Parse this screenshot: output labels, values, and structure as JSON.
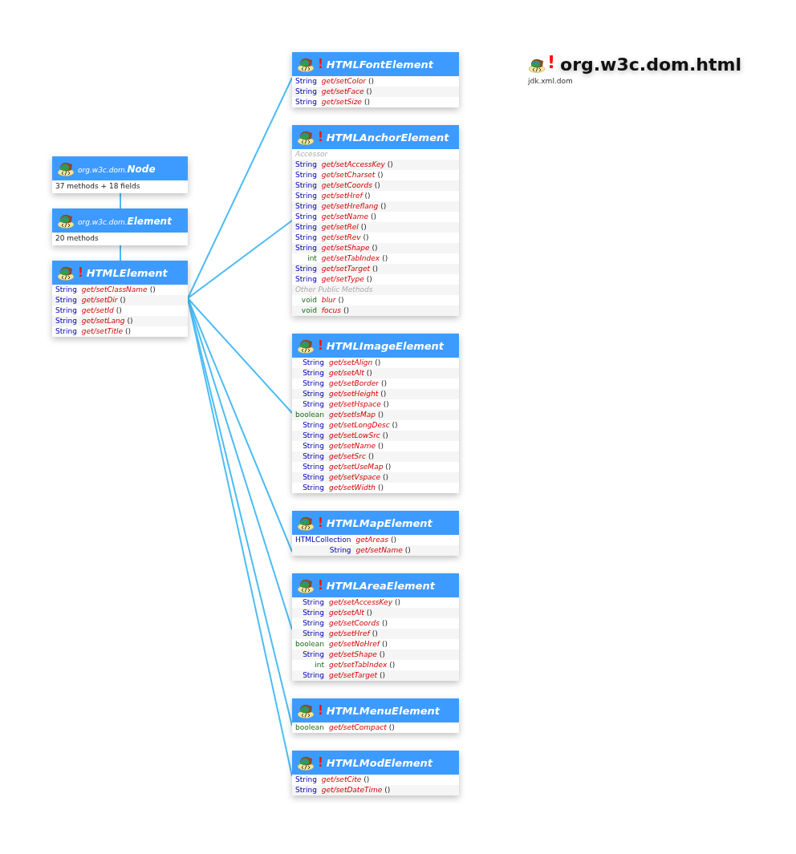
{
  "title": {
    "mark": "!",
    "package": "org.w3c.dom.html",
    "module": "jdk.xml.dom"
  },
  "classes": [
    {
      "kind": "external",
      "prefix": "org.w3c.dom.",
      "name": "Node",
      "summary": "37 methods + 18 fields"
    },
    {
      "kind": "external",
      "prefix": "org.w3c.dom.",
      "name": "Element",
      "summary": "20 methods"
    },
    {
      "kind": "interface",
      "mark": "!",
      "name": "HTMLElement",
      "rows": [
        {
          "kind": "object",
          "type": "String",
          "name": "get/setClassName",
          "params": "()"
        },
        {
          "kind": "object",
          "type": "String",
          "name": "get/setDir",
          "params": "()"
        },
        {
          "kind": "object",
          "type": "String",
          "name": "get/setId",
          "params": "()"
        },
        {
          "kind": "object",
          "type": "String",
          "name": "get/setLang",
          "params": "()"
        },
        {
          "kind": "object",
          "type": "String",
          "name": "get/setTitle",
          "params": "()"
        }
      ]
    },
    {
      "kind": "interface",
      "mark": "!",
      "name": "HTMLFontElement",
      "rows": [
        {
          "kind": "object",
          "type": "String",
          "name": "get/setColor",
          "params": "()"
        },
        {
          "kind": "object",
          "type": "String",
          "name": "get/setFace",
          "params": "()"
        },
        {
          "kind": "object",
          "type": "String",
          "name": "get/setSize",
          "params": "()"
        }
      ]
    },
    {
      "kind": "interface",
      "mark": "!",
      "name": "HTMLAnchorElement",
      "rows": [
        {
          "kind": "section",
          "label": "Accessor"
        },
        {
          "kind": "object",
          "type": "String",
          "name": "get/setAccessKey",
          "params": "()"
        },
        {
          "kind": "object",
          "type": "String",
          "name": "get/setCharset",
          "params": "()"
        },
        {
          "kind": "object",
          "type": "String",
          "name": "get/setCoords",
          "params": "()"
        },
        {
          "kind": "object",
          "type": "String",
          "name": "get/setHref",
          "params": "()"
        },
        {
          "kind": "object",
          "type": "String",
          "name": "get/setHreflang",
          "params": "()"
        },
        {
          "kind": "object",
          "type": "String",
          "name": "get/setName",
          "params": "()"
        },
        {
          "kind": "object",
          "type": "String",
          "name": "get/setRel",
          "params": "()"
        },
        {
          "kind": "object",
          "type": "String",
          "name": "get/setRev",
          "params": "()"
        },
        {
          "kind": "object",
          "type": "String",
          "name": "get/setShape",
          "params": "()"
        },
        {
          "kind": "primitive",
          "type": "int",
          "name": "get/setTabIndex",
          "params": "()"
        },
        {
          "kind": "object",
          "type": "String",
          "name": "get/setTarget",
          "params": "()"
        },
        {
          "kind": "object",
          "type": "String",
          "name": "get/setType",
          "params": "()"
        },
        {
          "kind": "section",
          "label": "Other Public Methods"
        },
        {
          "kind": "primitive",
          "type": "void",
          "name": "blur",
          "params": "()"
        },
        {
          "kind": "primitive",
          "type": "void",
          "name": "focus",
          "params": "()"
        }
      ]
    },
    {
      "kind": "interface",
      "mark": "!",
      "name": "HTMLImageElement",
      "rows": [
        {
          "kind": "object",
          "type": "String",
          "name": "get/setAlign",
          "params": "()"
        },
        {
          "kind": "object",
          "type": "String",
          "name": "get/setAlt",
          "params": "()"
        },
        {
          "kind": "object",
          "type": "String",
          "name": "get/setBorder",
          "params": "()"
        },
        {
          "kind": "object",
          "type": "String",
          "name": "get/setHeight",
          "params": "()"
        },
        {
          "kind": "object",
          "type": "String",
          "name": "get/setHspace",
          "params": "()"
        },
        {
          "kind": "primitive",
          "type": "boolean",
          "name": "get/setIsMap",
          "params": "()"
        },
        {
          "kind": "object",
          "type": "String",
          "name": "get/setLongDesc",
          "params": "()"
        },
        {
          "kind": "object",
          "type": "String",
          "name": "get/setLowSrc",
          "params": "()"
        },
        {
          "kind": "object",
          "type": "String",
          "name": "get/setName",
          "params": "()"
        },
        {
          "kind": "object",
          "type": "String",
          "name": "get/setSrc",
          "params": "()"
        },
        {
          "kind": "object",
          "type": "String",
          "name": "get/setUseMap",
          "params": "()"
        },
        {
          "kind": "object",
          "type": "String",
          "name": "get/setVspace",
          "params": "()"
        },
        {
          "kind": "object",
          "type": "String",
          "name": "get/setWidth",
          "params": "()"
        }
      ]
    },
    {
      "kind": "interface",
      "mark": "!",
      "name": "HTMLMapElement",
      "rows": [
        {
          "kind": "object",
          "type": "HTMLCollection",
          "name": "getAreas",
          "params": "()"
        },
        {
          "kind": "object",
          "type": "String",
          "name": "get/setName",
          "params": "()"
        }
      ]
    },
    {
      "kind": "interface",
      "mark": "!",
      "name": "HTMLAreaElement",
      "rows": [
        {
          "kind": "object",
          "type": "String",
          "name": "get/setAccessKey",
          "params": "()"
        },
        {
          "kind": "object",
          "type": "String",
          "name": "get/setAlt",
          "params": "()"
        },
        {
          "kind": "object",
          "type": "String",
          "name": "get/setCoords",
          "params": "()"
        },
        {
          "kind": "object",
          "type": "String",
          "name": "get/setHref",
          "params": "()"
        },
        {
          "kind": "primitive",
          "type": "boolean",
          "name": "get/setNoHref",
          "params": "()"
        },
        {
          "kind": "object",
          "type": "String",
          "name": "get/setShape",
          "params": "()"
        },
        {
          "kind": "primitive",
          "type": "int",
          "name": "get/setTabIndex",
          "params": "()"
        },
        {
          "kind": "object",
          "type": "String",
          "name": "get/setTarget",
          "params": "()"
        }
      ]
    },
    {
      "kind": "interface",
      "mark": "!",
      "name": "HTMLMenuElement",
      "rows": [
        {
          "kind": "primitive",
          "type": "boolean",
          "name": "get/setCompact",
          "params": "()"
        }
      ]
    },
    {
      "kind": "interface",
      "mark": "!",
      "name": "HTMLModElement",
      "rows": [
        {
          "kind": "object",
          "type": "String",
          "name": "get/setCite",
          "params": "()"
        },
        {
          "kind": "object",
          "type": "String",
          "name": "get/setDateTime",
          "params": "()"
        }
      ]
    }
  ]
}
